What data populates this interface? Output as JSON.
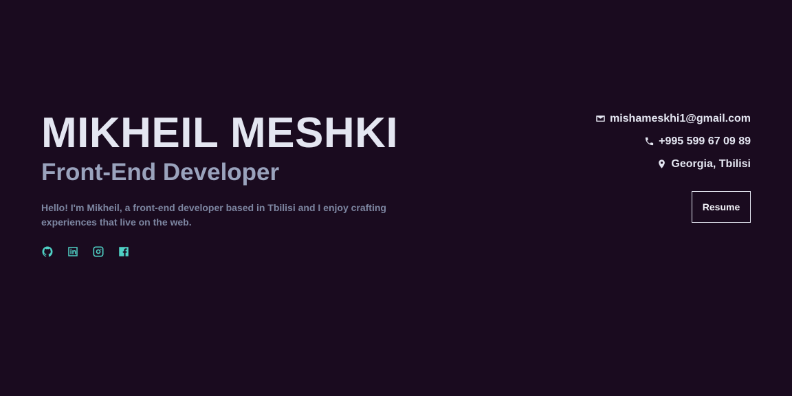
{
  "hero": {
    "name": "MIKHEIL MESHKI",
    "role": "Front-End Developer",
    "bio": "Hello! I'm Mikheil, a front-end developer based in Tbilisi and I enjoy crafting experiences that live on the web."
  },
  "socials": [
    {
      "icon": "github-icon",
      "label": "GitHub"
    },
    {
      "icon": "linkedin-icon",
      "label": "LinkedIn"
    },
    {
      "icon": "instagram-icon",
      "label": "Instagram"
    },
    {
      "icon": "facebook-icon",
      "label": "Facebook"
    }
  ],
  "contact": {
    "email": "mishameskhi1@gmail.com",
    "phone": "+995 599 67 09 89",
    "location": "Georgia, Tbilisi"
  },
  "actions": {
    "resume_label": "Resume"
  },
  "colors": {
    "background": "#1a0b1f",
    "heading": "#e4e6f1",
    "subheading": "#9aa3bd",
    "body": "#7d86a1",
    "accent": "#4fd1c5"
  }
}
